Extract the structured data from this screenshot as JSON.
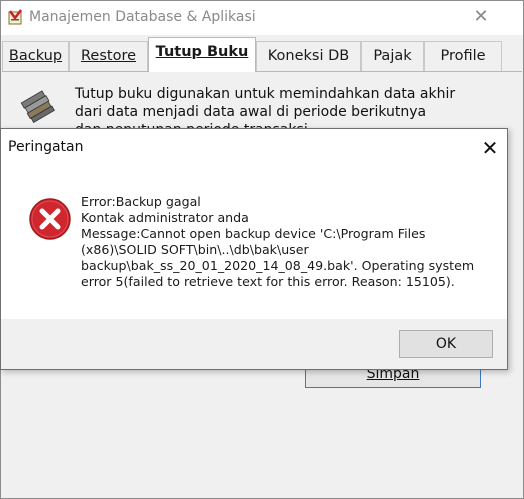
{
  "window": {
    "title": "Manajemen Database & Aplikasi",
    "close_glyph": "✕"
  },
  "tabs": [
    {
      "label": "Backup",
      "active": false
    },
    {
      "label": "Restore",
      "active": false
    },
    {
      "label": "Tutup Buku",
      "active": true
    },
    {
      "label": "Koneksi DB",
      "active": false
    },
    {
      "label": "Pajak",
      "active": false
    },
    {
      "label": "Profile",
      "active": false
    }
  ],
  "panel": {
    "description": "Tutup buku digunakan untuk memindahkan data akhir\ndari data menjadi data awal di periode berikutnya\ndan penutupan periode transaksi",
    "save_button_label": "Simpan"
  },
  "dialog": {
    "title": "Peringatan",
    "close_glyph": "✕",
    "message": "Error:Backup gagal\nKontak administrator anda\nMessage:Cannot open backup device 'C:\\Program Files\n(x86)\\SOLID SOFT\\bin\\..\\db\\bak\\user\nbackup\\bak_ss_20_01_2020_14_08_49.bak'. Operating system\nerror 5(failed to retrieve text for this error. Reason: 15105).",
    "ok_label": "OK",
    "icon": "error-icon"
  },
  "colors": {
    "error_red": "#d0262d",
    "focus_blue": "#3c7ac4"
  }
}
